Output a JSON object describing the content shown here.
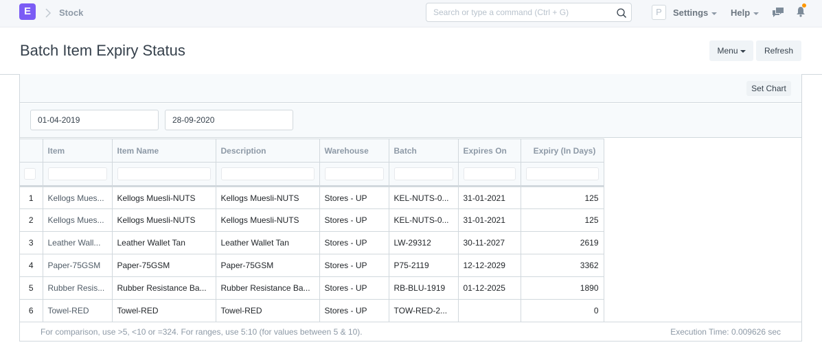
{
  "navbar": {
    "logo_letter": "E",
    "breadcrumb": "Stock",
    "search_placeholder": "Search or type a command (Ctrl + G)",
    "avatar_letter": "P",
    "settings_label": "Settings",
    "help_label": "Help",
    "accent_color": "#7b5cf5",
    "notification_dot_color": "#ff9800"
  },
  "page": {
    "title": "Batch Item Expiry Status",
    "menu_label": "Menu",
    "refresh_label": "Refresh",
    "set_chart_label": "Set Chart"
  },
  "filters": {
    "from_date": "01-04-2019",
    "to_date": "28-09-2020"
  },
  "table": {
    "columns": [
      "",
      "Item",
      "Item Name",
      "Description",
      "Warehouse",
      "Batch",
      "Expires On",
      "Expiry (In Days)"
    ],
    "rows": [
      {
        "n": "1",
        "item": "Kellogs Mues...",
        "item_name": "Kellogs Muesli-NUTS",
        "description": "Kellogs Muesli-NUTS",
        "warehouse": "Stores - UP",
        "batch": "KEL-NUTS-0...",
        "expires_on": "31-01-2021",
        "expiry_days": "125"
      },
      {
        "n": "2",
        "item": "Kellogs Mues...",
        "item_name": "Kellogs Muesli-NUTS",
        "description": "Kellogs Muesli-NUTS",
        "warehouse": "Stores - UP",
        "batch": "KEL-NUTS-0...",
        "expires_on": "31-01-2021",
        "expiry_days": "125"
      },
      {
        "n": "3",
        "item": "Leather Wall...",
        "item_name": "Leather Wallet Tan",
        "description": "Leather Wallet Tan",
        "warehouse": "Stores - UP",
        "batch": "LW-29312",
        "expires_on": "30-11-2027",
        "expiry_days": "2619"
      },
      {
        "n": "4",
        "item": "Paper-75GSM",
        "item_name": "Paper-75GSM",
        "description": "Paper-75GSM",
        "warehouse": "Stores - UP",
        "batch": "P75-2119",
        "expires_on": "12-12-2029",
        "expiry_days": "3362"
      },
      {
        "n": "5",
        "item": "Rubber Resis...",
        "item_name": "Rubber Resistance Ba...",
        "description": "Rubber Resistance Ba...",
        "warehouse": "Stores - UP",
        "batch": "RB-BLU-1919",
        "expires_on": "01-12-2025",
        "expiry_days": "1890"
      },
      {
        "n": "6",
        "item": "Towel-RED",
        "item_name": "Towel-RED",
        "description": "Towel-RED",
        "warehouse": "Stores - UP",
        "batch": "TOW-RED-2...",
        "expires_on": "",
        "expiry_days": "0"
      }
    ]
  },
  "footer": {
    "hint": "For comparison, use >5, <10 or =324. For ranges, use 5:10 (for values between 5 & 10).",
    "execution_time": "Execution Time: 0.009626 sec"
  }
}
